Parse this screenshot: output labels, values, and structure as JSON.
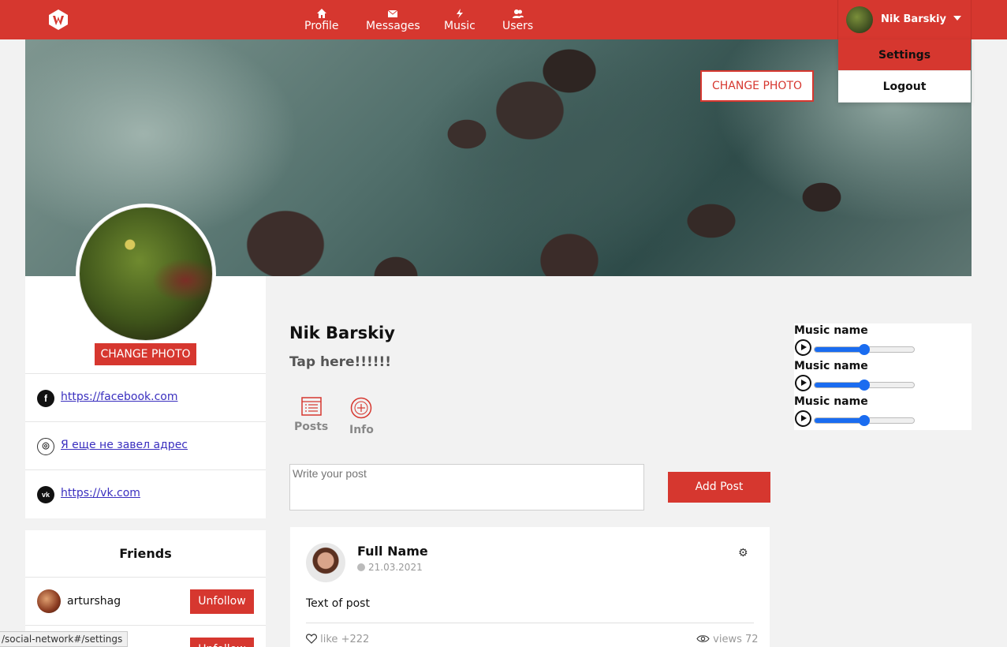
{
  "header": {
    "logo_icon": "w-logo-icon",
    "nav": [
      {
        "label": "Profile",
        "icon": "home-icon",
        "active": true
      },
      {
        "label": "Messages",
        "icon": "envelope-icon",
        "active": false
      },
      {
        "label": "Music",
        "icon": "lightning-icon",
        "active": false
      },
      {
        "label": "Users",
        "icon": "users-icon",
        "active": false
      }
    ],
    "user_name": "Nik Barskiy"
  },
  "user_menu": {
    "items": [
      {
        "label": "Settings",
        "selected": true
      },
      {
        "label": "Logout",
        "selected": false
      }
    ]
  },
  "cover": {
    "change_photo_label": "CHANGE PHOTO"
  },
  "avatar": {
    "change_photo_label": "CHANGE PHOTO"
  },
  "contacts": [
    {
      "icon": "facebook-icon",
      "glyph": "f",
      "text": "https://facebook.com"
    },
    {
      "icon": "globe-icon",
      "glyph": "◎",
      "text": "Я еще не завел адрес"
    },
    {
      "icon": "vk-icon",
      "glyph": "vk",
      "text": "https://vk.com"
    }
  ],
  "friends": {
    "title": "Friends",
    "items": [
      {
        "name": "arturshag",
        "button": "Unfollow"
      },
      {
        "name": "",
        "button": "Unfollow"
      }
    ]
  },
  "status_bar_url": "/social-network#/settings",
  "profile": {
    "name": "Nik Barskiy",
    "status": "Tap here!!!!!!"
  },
  "tabs": [
    {
      "label": "Posts",
      "icon": "list-icon"
    },
    {
      "label": "Info",
      "icon": "info-icon"
    }
  ],
  "composer": {
    "placeholder": "Write your post",
    "add_label": "Add Post"
  },
  "post": {
    "author": "Full Name",
    "date": "21.03.2021",
    "text": "Text of post",
    "like_label": "like",
    "like_count": "+222",
    "views_label": "views",
    "views_count": "72"
  },
  "music": [
    {
      "name": "Music name",
      "progress": 0.5
    },
    {
      "name": "Music name",
      "progress": 0.5
    },
    {
      "name": "Music name",
      "progress": 0.5
    }
  ],
  "colors": {
    "accent": "#d6372f",
    "slider": "#1a6cf0",
    "link": "#3a2fbf"
  }
}
